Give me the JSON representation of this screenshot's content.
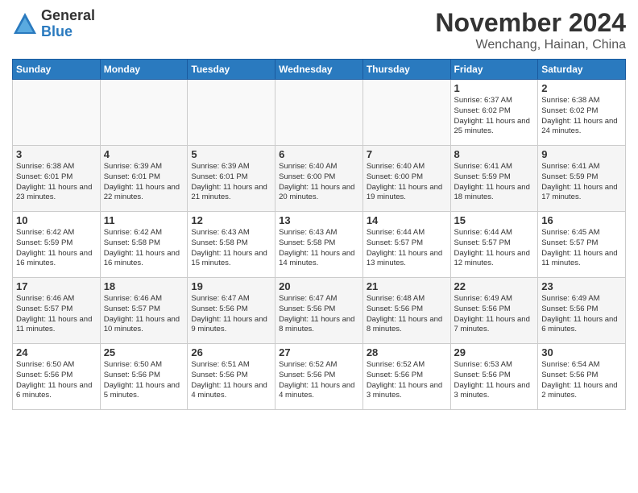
{
  "logo": {
    "general": "General",
    "blue": "Blue"
  },
  "title": "November 2024",
  "location": "Wenchang, Hainan, China",
  "days_of_week": [
    "Sunday",
    "Monday",
    "Tuesday",
    "Wednesday",
    "Thursday",
    "Friday",
    "Saturday"
  ],
  "weeks": [
    [
      {
        "day": "",
        "info": ""
      },
      {
        "day": "",
        "info": ""
      },
      {
        "day": "",
        "info": ""
      },
      {
        "day": "",
        "info": ""
      },
      {
        "day": "",
        "info": ""
      },
      {
        "day": "1",
        "info": "Sunrise: 6:37 AM\nSunset: 6:02 PM\nDaylight: 11 hours and 25 minutes."
      },
      {
        "day": "2",
        "info": "Sunrise: 6:38 AM\nSunset: 6:02 PM\nDaylight: 11 hours and 24 minutes."
      }
    ],
    [
      {
        "day": "3",
        "info": "Sunrise: 6:38 AM\nSunset: 6:01 PM\nDaylight: 11 hours and 23 minutes."
      },
      {
        "day": "4",
        "info": "Sunrise: 6:39 AM\nSunset: 6:01 PM\nDaylight: 11 hours and 22 minutes."
      },
      {
        "day": "5",
        "info": "Sunrise: 6:39 AM\nSunset: 6:01 PM\nDaylight: 11 hours and 21 minutes."
      },
      {
        "day": "6",
        "info": "Sunrise: 6:40 AM\nSunset: 6:00 PM\nDaylight: 11 hours and 20 minutes."
      },
      {
        "day": "7",
        "info": "Sunrise: 6:40 AM\nSunset: 6:00 PM\nDaylight: 11 hours and 19 minutes."
      },
      {
        "day": "8",
        "info": "Sunrise: 6:41 AM\nSunset: 5:59 PM\nDaylight: 11 hours and 18 minutes."
      },
      {
        "day": "9",
        "info": "Sunrise: 6:41 AM\nSunset: 5:59 PM\nDaylight: 11 hours and 17 minutes."
      }
    ],
    [
      {
        "day": "10",
        "info": "Sunrise: 6:42 AM\nSunset: 5:59 PM\nDaylight: 11 hours and 16 minutes."
      },
      {
        "day": "11",
        "info": "Sunrise: 6:42 AM\nSunset: 5:58 PM\nDaylight: 11 hours and 16 minutes."
      },
      {
        "day": "12",
        "info": "Sunrise: 6:43 AM\nSunset: 5:58 PM\nDaylight: 11 hours and 15 minutes."
      },
      {
        "day": "13",
        "info": "Sunrise: 6:43 AM\nSunset: 5:58 PM\nDaylight: 11 hours and 14 minutes."
      },
      {
        "day": "14",
        "info": "Sunrise: 6:44 AM\nSunset: 5:57 PM\nDaylight: 11 hours and 13 minutes."
      },
      {
        "day": "15",
        "info": "Sunrise: 6:44 AM\nSunset: 5:57 PM\nDaylight: 11 hours and 12 minutes."
      },
      {
        "day": "16",
        "info": "Sunrise: 6:45 AM\nSunset: 5:57 PM\nDaylight: 11 hours and 11 minutes."
      }
    ],
    [
      {
        "day": "17",
        "info": "Sunrise: 6:46 AM\nSunset: 5:57 PM\nDaylight: 11 hours and 11 minutes."
      },
      {
        "day": "18",
        "info": "Sunrise: 6:46 AM\nSunset: 5:57 PM\nDaylight: 11 hours and 10 minutes."
      },
      {
        "day": "19",
        "info": "Sunrise: 6:47 AM\nSunset: 5:56 PM\nDaylight: 11 hours and 9 minutes."
      },
      {
        "day": "20",
        "info": "Sunrise: 6:47 AM\nSunset: 5:56 PM\nDaylight: 11 hours and 8 minutes."
      },
      {
        "day": "21",
        "info": "Sunrise: 6:48 AM\nSunset: 5:56 PM\nDaylight: 11 hours and 8 minutes."
      },
      {
        "day": "22",
        "info": "Sunrise: 6:49 AM\nSunset: 5:56 PM\nDaylight: 11 hours and 7 minutes."
      },
      {
        "day": "23",
        "info": "Sunrise: 6:49 AM\nSunset: 5:56 PM\nDaylight: 11 hours and 6 minutes."
      }
    ],
    [
      {
        "day": "24",
        "info": "Sunrise: 6:50 AM\nSunset: 5:56 PM\nDaylight: 11 hours and 6 minutes."
      },
      {
        "day": "25",
        "info": "Sunrise: 6:50 AM\nSunset: 5:56 PM\nDaylight: 11 hours and 5 minutes."
      },
      {
        "day": "26",
        "info": "Sunrise: 6:51 AM\nSunset: 5:56 PM\nDaylight: 11 hours and 4 minutes."
      },
      {
        "day": "27",
        "info": "Sunrise: 6:52 AM\nSunset: 5:56 PM\nDaylight: 11 hours and 4 minutes."
      },
      {
        "day": "28",
        "info": "Sunrise: 6:52 AM\nSunset: 5:56 PM\nDaylight: 11 hours and 3 minutes."
      },
      {
        "day": "29",
        "info": "Sunrise: 6:53 AM\nSunset: 5:56 PM\nDaylight: 11 hours and 3 minutes."
      },
      {
        "day": "30",
        "info": "Sunrise: 6:54 AM\nSunset: 5:56 PM\nDaylight: 11 hours and 2 minutes."
      }
    ]
  ]
}
